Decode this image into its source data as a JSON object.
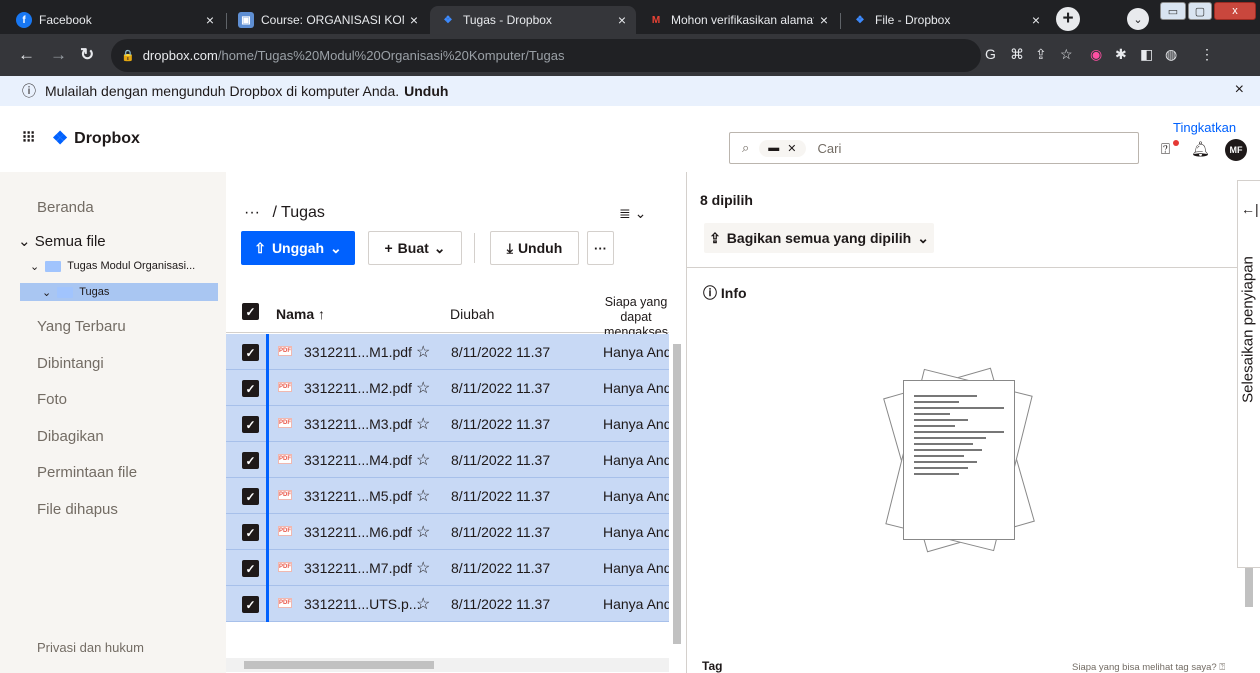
{
  "browser": {
    "tabs": [
      {
        "label": "Facebook",
        "close": "×",
        "icon": "facebook-icon",
        "iconColor": "#1877f2",
        "iconGlyph": "f"
      },
      {
        "label": "Course: ORGANISASI KOMPUT",
        "close": "×",
        "icon": "moodle-icon",
        "iconColor": "#5f8fd3",
        "iconGlyph": "▣"
      },
      {
        "label": "Tugas - Dropbox",
        "close": "×",
        "icon": "dropbox-icon",
        "iconColor": "#0061fe",
        "iconGlyph": "❖"
      },
      {
        "label": "Mohon verifikasikan alamat em",
        "close": "×",
        "icon": "gmail-icon",
        "iconColor": "#ea4335",
        "iconGlyph": "M"
      },
      {
        "label": "File - Dropbox",
        "close": "×",
        "icon": "dropbox-icon",
        "iconColor": "#0061fe",
        "iconGlyph": "❖"
      }
    ],
    "new_tab": "+",
    "url_host": "dropbox.com",
    "url_path": "/home/Tugas%20Modul%20Organisasi%20Komputer/Tugas"
  },
  "infobar": {
    "text": "Mulailah dengan mengunduh Dropbox di komputer Anda.",
    "link": "Unduh",
    "close": "×"
  },
  "header": {
    "logo": "Dropbox",
    "upgrade": "Tingkatkan",
    "search_placeholder": "Cari",
    "avatar": "MF"
  },
  "sidebar": {
    "items": [
      "Beranda",
      "Semua file",
      "Yang Terbaru",
      "Dibintangi",
      "Foto",
      "Dibagikan",
      "Permintaan file",
      "File dihapus"
    ],
    "tree": [
      "Tugas Modul Organisasi...",
      "Tugas"
    ],
    "footer": "Privasi dan hukum"
  },
  "main": {
    "crumb_parent": "···",
    "crumb_sep": "/",
    "crumb_current": "Tugas",
    "upload": "Unggah",
    "create": "Buat",
    "download": "Unduh",
    "more": "···",
    "columns": {
      "name": "Nama",
      "modified": "Diubah",
      "access_line1": "Siapa yang",
      "access_line2": "dapat",
      "access_line3": "mengakses"
    },
    "files": [
      {
        "name": "3312211...M1.pdf",
        "date": "8/11/2022 11.37",
        "access": "Hanya Anda"
      },
      {
        "name": "3312211...M2.pdf",
        "date": "8/11/2022 11.37",
        "access": "Hanya Anda"
      },
      {
        "name": "3312211...M3.pdf",
        "date": "8/11/2022 11.37",
        "access": "Hanya Anda"
      },
      {
        "name": "3312211...M4.pdf",
        "date": "8/11/2022 11.37",
        "access": "Hanya Anda"
      },
      {
        "name": "3312211...M5.pdf",
        "date": "8/11/2022 11.37",
        "access": "Hanya Anda"
      },
      {
        "name": "3312211...M6.pdf",
        "date": "8/11/2022 11.37",
        "access": "Hanya Anda"
      },
      {
        "name": "3312211...M7.pdf",
        "date": "8/11/2022 11.37",
        "access": "Hanya Anda"
      },
      {
        "name": "3312211...UTS.p...",
        "date": "8/11/2022 11.37",
        "access": "Hanya Anda"
      }
    ]
  },
  "panel": {
    "selected": "8 dipilih",
    "share": "Bagikan semua yang dipilih",
    "info": "Info",
    "tag": "Tag",
    "tag_question": "Siapa yang bisa melihat tag saya?",
    "feedback": "Selesaikan penyiapan"
  }
}
